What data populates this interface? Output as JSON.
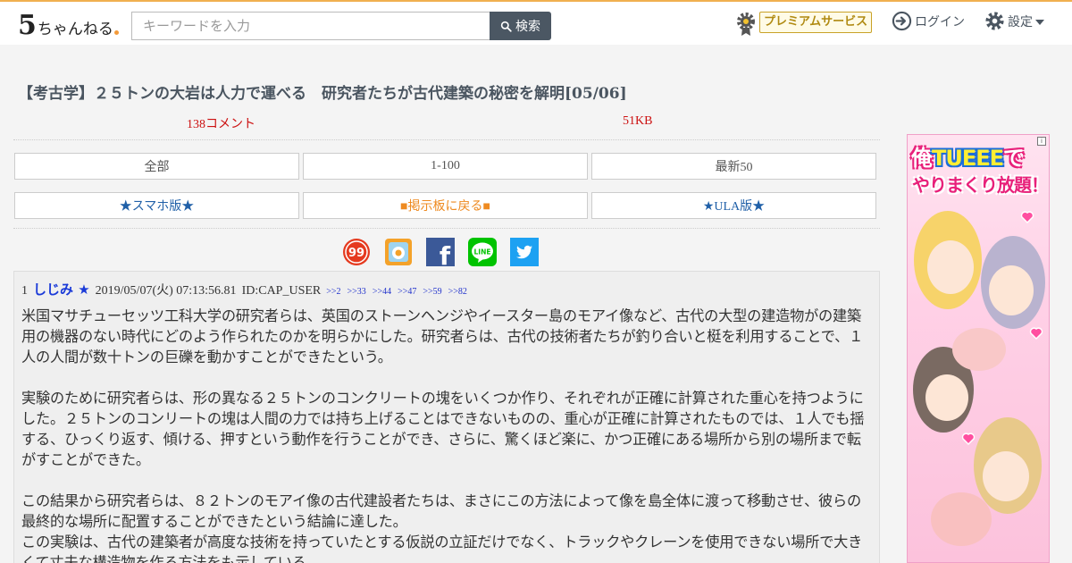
{
  "header": {
    "logo_five": "5",
    "logo_rest": "ちゃんねる",
    "search_placeholder": "キーワードを入力",
    "search_button": "検索",
    "premium_label": "プレミアムサービス",
    "login_label": "ログイン",
    "settings_label": "設定"
  },
  "thread": {
    "title": "【考古学】２５トンの大岩は人力で運べる　研究者たちが古代建築の秘密を解明[05/06]",
    "comments": "138コメント",
    "size": "51KB"
  },
  "nav": {
    "row1": [
      "全部",
      "1-100",
      "最新50"
    ],
    "row2": [
      "★スマホ版★",
      "■掲示板に戻る■",
      "★ULA版★"
    ]
  },
  "share": {
    "items": [
      {
        "name": "share-icon-99",
        "label": "99"
      },
      {
        "name": "share-icon-app",
        "label": ""
      },
      {
        "name": "facebook-icon",
        "label": "f"
      },
      {
        "name": "line-icon",
        "label": "LINE"
      },
      {
        "name": "twitter-icon",
        "label": ""
      }
    ],
    "colors": {
      "facebook": "#3b5998",
      "line": "#00c300",
      "twitter": "#1da1f2"
    }
  },
  "post": {
    "number": "1",
    "name": "しじみ ★",
    "date": "2019/05/07(火) 07:13:56.81",
    "id": "ID:CAP_USER",
    "refs": [
      ">>2",
      ">>33",
      ">>44",
      ">>47",
      ">>59",
      ">>82"
    ],
    "body": [
      "米国マサチューセッツ工科大学の研究者らは、英国のストーンヘンジやイースター島のモアイ像など、古代の大型の建造物がの建築用の機器のない時代にどのよう作られたのかを明らかにした。研究者らは、古代の技術者たちが釣り合いと梃を利用することで、１人の人間が数十トンの巨礫を動かすことができたという。",
      "",
      "実験のために研究者らは、形の異なる２５トンのコンクリートの塊をいくつか作り、それぞれが正確に計算された重心を持つようにした。２５トンのコンリートの塊は人間の力では持ち上げることはできないものの、重心が正確に計算されたものでは、１人でも揺する、ひっくり返す、傾ける、押すという動作を行うことができ、さらに、驚くほど楽に、かつ正確にある場所から別の場所まで転がすことができた。",
      "",
      "この結果から研究者らは、８２トンのモアイ像の古代建設者たちは、まさにこの方法によって像を島全体に渡って移動させ、彼らの最終的な場所に配置することができたという結論に達した。",
      "この実験は、古代の建築者が高度な技術を持っていたとする仮説の立証だけでなく、トラックやクレーンを使用できない場所で大きくて丈夫な構造物を作る方法をも示している。"
    ]
  },
  "ad": {
    "line1_a": "俺",
    "line1_b": "TUEEE",
    "line1_c": "で",
    "line2": "やりまくり放題！",
    "info": "i"
  }
}
